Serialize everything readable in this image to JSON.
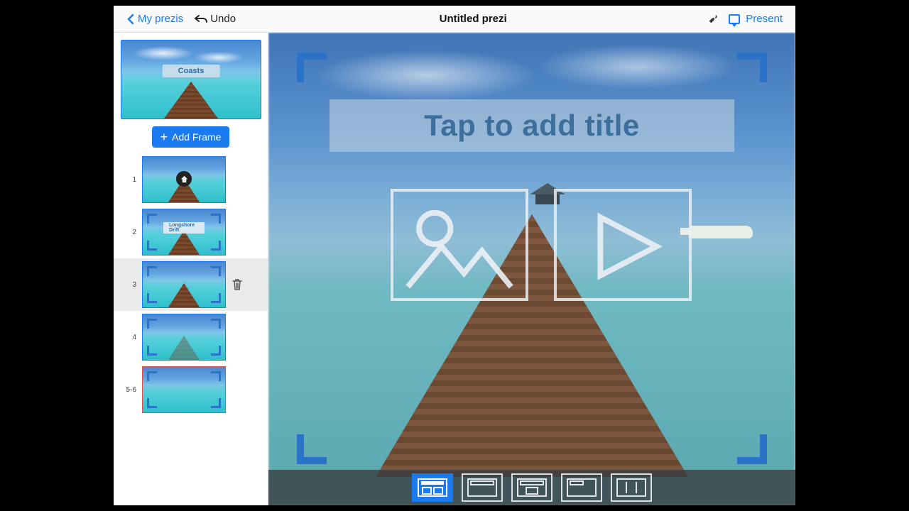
{
  "header": {
    "back_label": "My prezis",
    "undo_label": "Undo",
    "title": "Untitled prezi",
    "present_label": "Present"
  },
  "sidebar": {
    "hero_title": "Coasts",
    "add_frame_label": "Add Frame",
    "frames": [
      {
        "num": "1",
        "label": ""
      },
      {
        "num": "2",
        "label": "Longshore Drift"
      },
      {
        "num": "3",
        "label": ""
      },
      {
        "num": "4",
        "label": ""
      },
      {
        "num": "5-6",
        "label": ""
      }
    ]
  },
  "canvas": {
    "title_placeholder": "Tap to add title"
  },
  "layouts": [
    "image-title",
    "title-bar",
    "title-image",
    "title-corner",
    "two-column"
  ],
  "colors": {
    "accent": "#1a7af0",
    "bracket": "#2b72c9"
  }
}
